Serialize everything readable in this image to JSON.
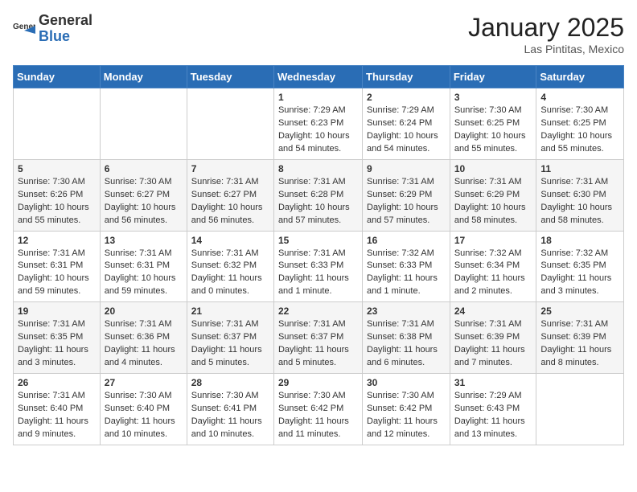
{
  "header": {
    "logo": {
      "general": "General",
      "blue": "Blue"
    },
    "title": "January 2025",
    "location": "Las Pintitas, Mexico"
  },
  "days_of_week": [
    "Sunday",
    "Monday",
    "Tuesday",
    "Wednesday",
    "Thursday",
    "Friday",
    "Saturday"
  ],
  "weeks": [
    [
      {
        "day": "",
        "info": ""
      },
      {
        "day": "",
        "info": ""
      },
      {
        "day": "",
        "info": ""
      },
      {
        "day": "1",
        "info": "Sunrise: 7:29 AM\nSunset: 6:23 PM\nDaylight: 10 hours\nand 54 minutes."
      },
      {
        "day": "2",
        "info": "Sunrise: 7:29 AM\nSunset: 6:24 PM\nDaylight: 10 hours\nand 54 minutes."
      },
      {
        "day": "3",
        "info": "Sunrise: 7:30 AM\nSunset: 6:25 PM\nDaylight: 10 hours\nand 55 minutes."
      },
      {
        "day": "4",
        "info": "Sunrise: 7:30 AM\nSunset: 6:25 PM\nDaylight: 10 hours\nand 55 minutes."
      }
    ],
    [
      {
        "day": "5",
        "info": "Sunrise: 7:30 AM\nSunset: 6:26 PM\nDaylight: 10 hours\nand 55 minutes."
      },
      {
        "day": "6",
        "info": "Sunrise: 7:30 AM\nSunset: 6:27 PM\nDaylight: 10 hours\nand 56 minutes."
      },
      {
        "day": "7",
        "info": "Sunrise: 7:31 AM\nSunset: 6:27 PM\nDaylight: 10 hours\nand 56 minutes."
      },
      {
        "day": "8",
        "info": "Sunrise: 7:31 AM\nSunset: 6:28 PM\nDaylight: 10 hours\nand 57 minutes."
      },
      {
        "day": "9",
        "info": "Sunrise: 7:31 AM\nSunset: 6:29 PM\nDaylight: 10 hours\nand 57 minutes."
      },
      {
        "day": "10",
        "info": "Sunrise: 7:31 AM\nSunset: 6:29 PM\nDaylight: 10 hours\nand 58 minutes."
      },
      {
        "day": "11",
        "info": "Sunrise: 7:31 AM\nSunset: 6:30 PM\nDaylight: 10 hours\nand 58 minutes."
      }
    ],
    [
      {
        "day": "12",
        "info": "Sunrise: 7:31 AM\nSunset: 6:31 PM\nDaylight: 10 hours\nand 59 minutes."
      },
      {
        "day": "13",
        "info": "Sunrise: 7:31 AM\nSunset: 6:31 PM\nDaylight: 10 hours\nand 59 minutes."
      },
      {
        "day": "14",
        "info": "Sunrise: 7:31 AM\nSunset: 6:32 PM\nDaylight: 11 hours\nand 0 minutes."
      },
      {
        "day": "15",
        "info": "Sunrise: 7:31 AM\nSunset: 6:33 PM\nDaylight: 11 hours\nand 1 minute."
      },
      {
        "day": "16",
        "info": "Sunrise: 7:32 AM\nSunset: 6:33 PM\nDaylight: 11 hours\nand 1 minute."
      },
      {
        "day": "17",
        "info": "Sunrise: 7:32 AM\nSunset: 6:34 PM\nDaylight: 11 hours\nand 2 minutes."
      },
      {
        "day": "18",
        "info": "Sunrise: 7:32 AM\nSunset: 6:35 PM\nDaylight: 11 hours\nand 3 minutes."
      }
    ],
    [
      {
        "day": "19",
        "info": "Sunrise: 7:31 AM\nSunset: 6:35 PM\nDaylight: 11 hours\nand 3 minutes."
      },
      {
        "day": "20",
        "info": "Sunrise: 7:31 AM\nSunset: 6:36 PM\nDaylight: 11 hours\nand 4 minutes."
      },
      {
        "day": "21",
        "info": "Sunrise: 7:31 AM\nSunset: 6:37 PM\nDaylight: 11 hours\nand 5 minutes."
      },
      {
        "day": "22",
        "info": "Sunrise: 7:31 AM\nSunset: 6:37 PM\nDaylight: 11 hours\nand 5 minutes."
      },
      {
        "day": "23",
        "info": "Sunrise: 7:31 AM\nSunset: 6:38 PM\nDaylight: 11 hours\nand 6 minutes."
      },
      {
        "day": "24",
        "info": "Sunrise: 7:31 AM\nSunset: 6:39 PM\nDaylight: 11 hours\nand 7 minutes."
      },
      {
        "day": "25",
        "info": "Sunrise: 7:31 AM\nSunset: 6:39 PM\nDaylight: 11 hours\nand 8 minutes."
      }
    ],
    [
      {
        "day": "26",
        "info": "Sunrise: 7:31 AM\nSunset: 6:40 PM\nDaylight: 11 hours\nand 9 minutes."
      },
      {
        "day": "27",
        "info": "Sunrise: 7:30 AM\nSunset: 6:40 PM\nDaylight: 11 hours\nand 10 minutes."
      },
      {
        "day": "28",
        "info": "Sunrise: 7:30 AM\nSunset: 6:41 PM\nDaylight: 11 hours\nand 10 minutes."
      },
      {
        "day": "29",
        "info": "Sunrise: 7:30 AM\nSunset: 6:42 PM\nDaylight: 11 hours\nand 11 minutes."
      },
      {
        "day": "30",
        "info": "Sunrise: 7:30 AM\nSunset: 6:42 PM\nDaylight: 11 hours\nand 12 minutes."
      },
      {
        "day": "31",
        "info": "Sunrise: 7:29 AM\nSunset: 6:43 PM\nDaylight: 11 hours\nand 13 minutes."
      },
      {
        "day": "",
        "info": ""
      }
    ]
  ]
}
